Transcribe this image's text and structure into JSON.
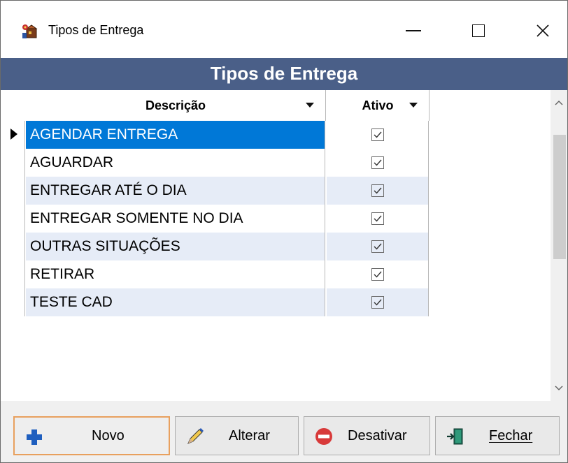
{
  "window": {
    "title": "Tipos de Entrega",
    "app_icon": "delivery-app-icon"
  },
  "header": {
    "title": "Tipos de Entrega"
  },
  "grid": {
    "columns": [
      {
        "label": "Descrição"
      },
      {
        "label": "Ativo"
      }
    ],
    "rows": [
      {
        "descricao": "AGENDAR ENTREGA",
        "ativo": true
      },
      {
        "descricao": "AGUARDAR",
        "ativo": true
      },
      {
        "descricao": "ENTREGAR ATÉ O DIA",
        "ativo": true
      },
      {
        "descricao": "ENTREGAR SOMENTE NO DIA",
        "ativo": true
      },
      {
        "descricao": "OUTRAS SITUAÇÕES",
        "ativo": true
      },
      {
        "descricao": "RETIRAR",
        "ativo": true
      },
      {
        "descricao": "TESTE CAD",
        "ativo": true
      }
    ],
    "selected_row": 0
  },
  "buttons": {
    "novo": "Novo",
    "alterar": "Alterar",
    "desativar": "Desativar",
    "fechar": "Fechar"
  },
  "colors": {
    "header_band": "#4a5f88",
    "selection": "#0078d7",
    "alt_row": "#e6ecf7",
    "focus_border": "#e8a05e"
  }
}
